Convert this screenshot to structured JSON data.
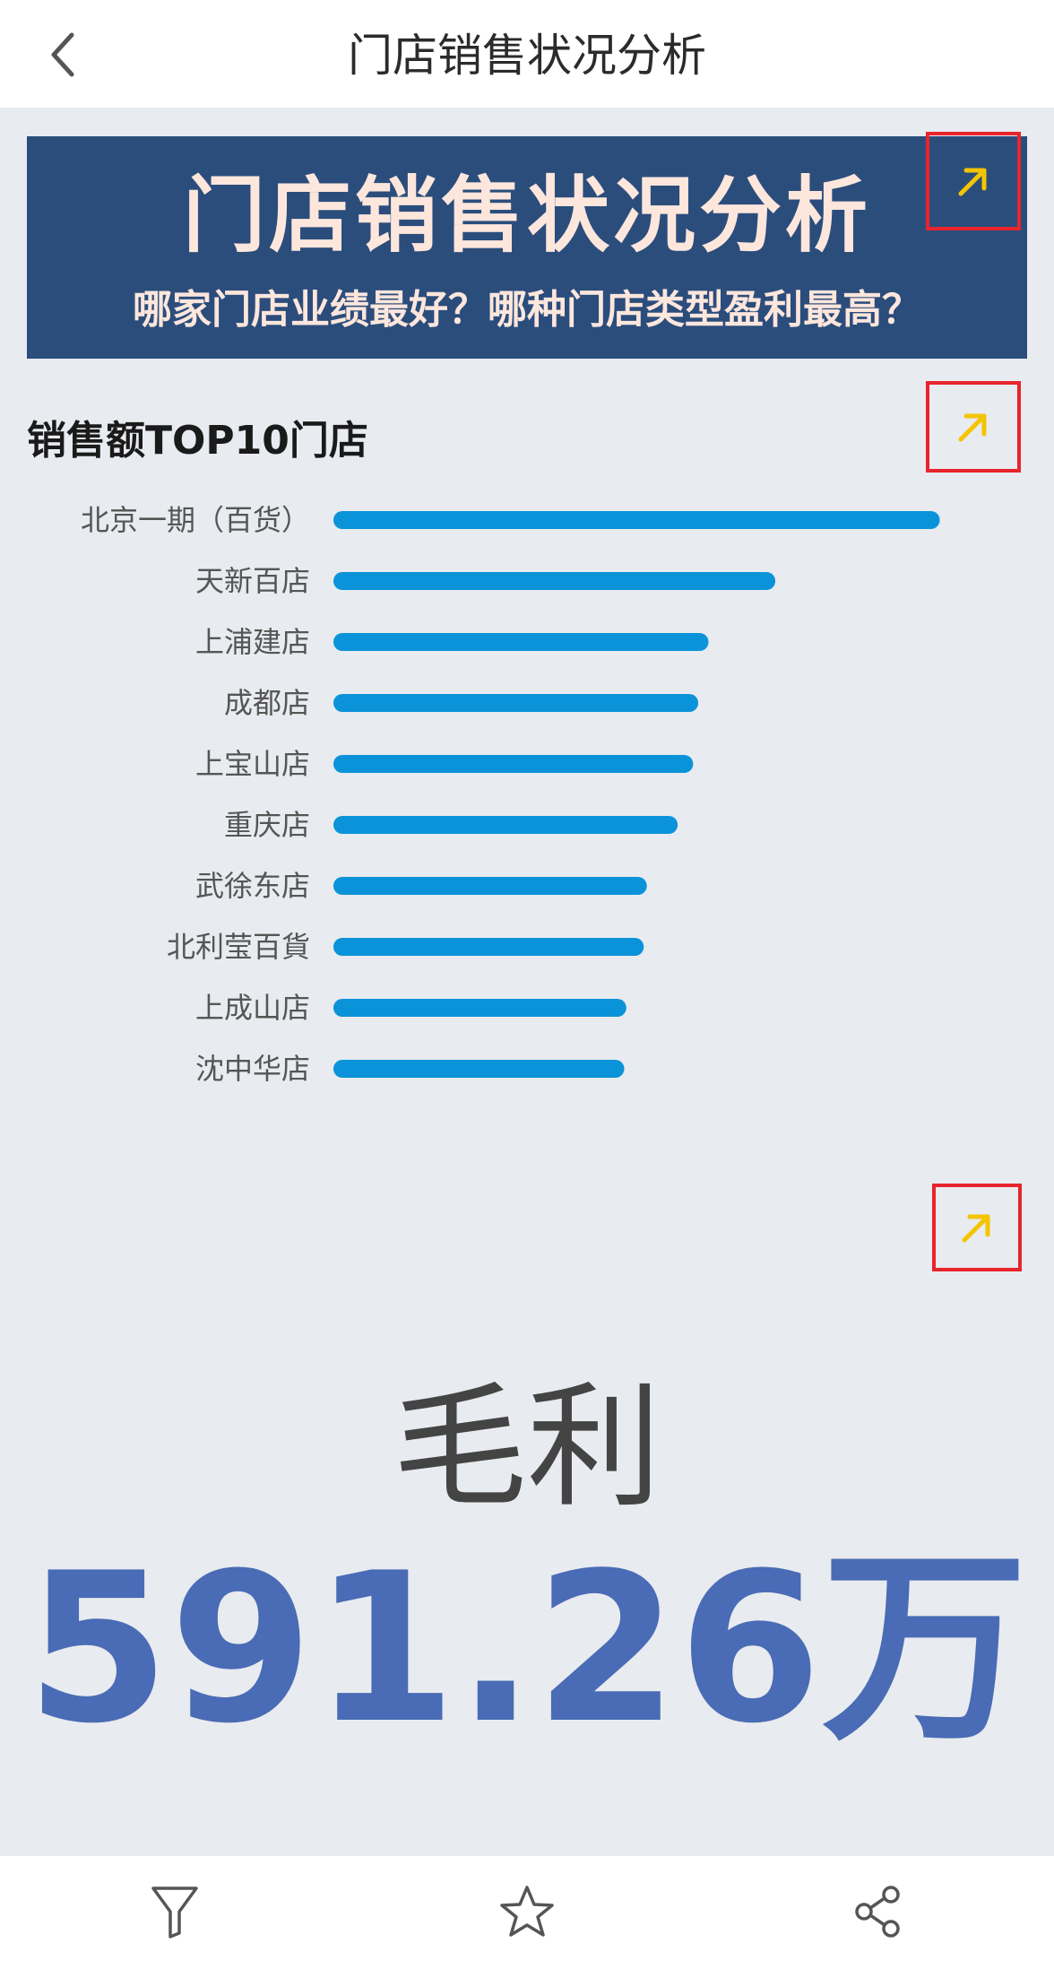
{
  "nav": {
    "title": "门店销售状况分析",
    "back_icon": "chevron-left-icon"
  },
  "banner": {
    "title": "门店销售状况分析",
    "subtitle": "哪家门店业绩最好？哪种门店类型盈利最高？",
    "background": "#2b4d7c",
    "text_color": "#fde6dc"
  },
  "chart_section": {
    "title": "销售额TOP10门店"
  },
  "chart_data": {
    "type": "bar",
    "orientation": "horizontal",
    "title": "销售额TOP10门店",
    "categories": [
      "北京一期（百货）",
      "天新百店",
      "上浦建店",
      "成都店",
      "上宝山店",
      "重庆店",
      "武徐东店",
      "北利莹百貨",
      "上成山店",
      "沈中华店"
    ],
    "values": [
      590,
      430,
      365,
      355,
      350,
      335,
      305,
      302,
      285,
      283
    ],
    "x_ticks": [
      {
        "value": 0,
        "label": "0万"
      },
      {
        "value": 200,
        "label": "200万"
      },
      {
        "value": 400,
        "label": "400万"
      },
      {
        "value": 600,
        "label": "600万"
      }
    ],
    "xlim": [
      0,
      600
    ],
    "bar_color": "#0b93d9",
    "grid": false,
    "legend": "none"
  },
  "kpi": {
    "label": "毛利",
    "value": "591.26万",
    "value_color": "#4a6bb5"
  },
  "expand_icons": {
    "icon": "expand-arrow-icon",
    "color": "#f5c400",
    "border_color": "#e8242d"
  },
  "bottom_bar": {
    "items": [
      {
        "icon": "filter-icon"
      },
      {
        "icon": "star-icon"
      },
      {
        "icon": "share-icon"
      }
    ]
  }
}
